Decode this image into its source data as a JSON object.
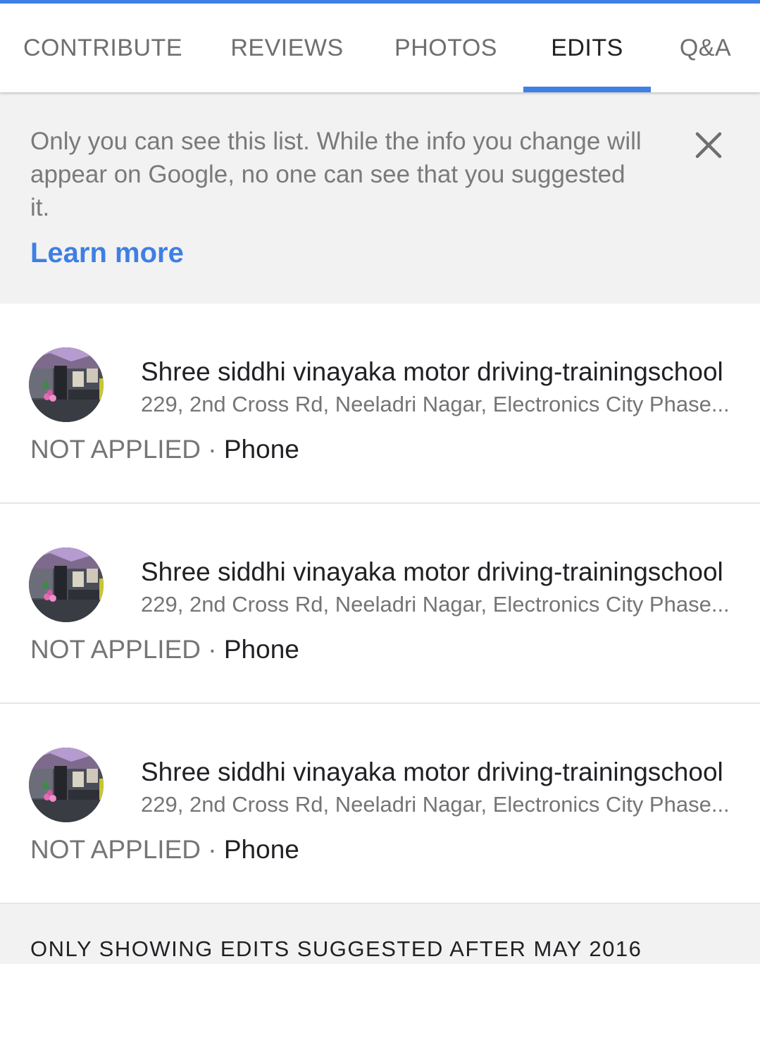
{
  "tabs": [
    {
      "label": "CONTRIBUTE"
    },
    {
      "label": "REVIEWS"
    },
    {
      "label": "PHOTOS"
    },
    {
      "label": "EDITS",
      "active": true
    },
    {
      "label": "Q&A"
    }
  ],
  "notice": {
    "text": "Only you can see this list. While the info you change will appear on Google, no one can see that you suggested it.",
    "link": "Learn more",
    "close_icon": "close-icon"
  },
  "edits": [
    {
      "name": "Shree siddhi vinayaka motor driving-trainingschool",
      "address": "229, 2nd Cross Rd, Neeladri Nagar, Electronics City Phase...",
      "status": "NOT APPLIED",
      "separator": "·",
      "field": "Phone"
    },
    {
      "name": "Shree siddhi vinayaka motor driving-trainingschool",
      "address": "229, 2nd Cross Rd, Neeladri Nagar, Electronics City Phase...",
      "status": "NOT APPLIED",
      "separator": "·",
      "field": "Phone"
    },
    {
      "name": "Shree siddhi vinayaka motor driving-trainingschool",
      "address": "229, 2nd Cross Rd, Neeladri Nagar, Electronics City Phase...",
      "status": "NOT APPLIED",
      "separator": "·",
      "field": "Phone"
    }
  ],
  "footer": {
    "text": "ONLY SHOWING EDITS SUGGESTED AFTER MAY 2016"
  },
  "colors": {
    "accent": "#3f7fe3",
    "banner_bg": "#f2f2f2",
    "muted_text": "#757575"
  }
}
